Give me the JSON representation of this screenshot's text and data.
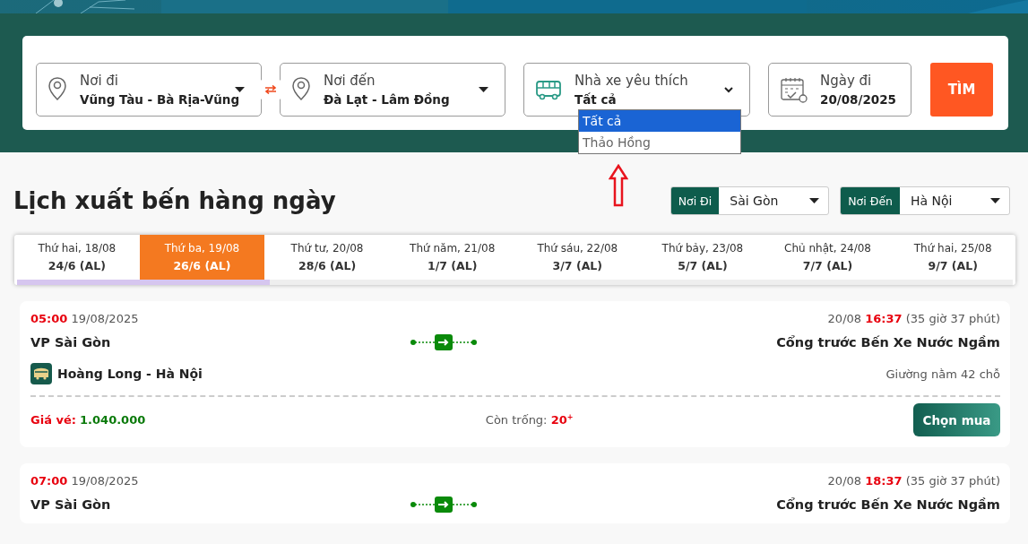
{
  "search": {
    "fields": [
      {
        "kind": "place",
        "label": "Nơi đi",
        "value": "Vũng Tàu - Bà Rịa-Vũng",
        "caret": true
      },
      {
        "kind": "place",
        "label": "Nơi đến",
        "value": "Đà Lạt - Lâm Đồng",
        "caret": true
      },
      {
        "kind": "operator",
        "label": "Nhà xe yêu thích",
        "value": "Tất cả",
        "expanded": true,
        "options": [
          {
            "label": "Tất cả",
            "selected": true
          },
          {
            "label": "Thảo Hồng",
            "selected": false
          }
        ]
      },
      {
        "kind": "date",
        "label": "Ngày đi",
        "value": "20/08/2025"
      }
    ],
    "button": "TÌM"
  },
  "schedule": {
    "title": "Lịch xuất bến hàng ngày",
    "filters": [
      {
        "label": "Nơi Đi",
        "value": "Sài Gòn"
      },
      {
        "label": "Nơi Đến",
        "value": "Hà Nội"
      }
    ],
    "days": [
      {
        "day": "Thứ hai, 18/08",
        "lunar": "24/6 (AL)",
        "selected": false
      },
      {
        "day": "Thứ ba, 19/08",
        "lunar": "26/6 (AL)",
        "selected": true
      },
      {
        "day": "Thứ tư, 20/08",
        "lunar": "28/6 (AL)",
        "selected": false
      },
      {
        "day": "Thứ năm, 21/08",
        "lunar": "1/7 (AL)",
        "selected": false
      },
      {
        "day": "Thứ sáu, 22/08",
        "lunar": "3/7 (AL)",
        "selected": false
      },
      {
        "day": "Thứ bảy, 23/08",
        "lunar": "5/7 (AL)",
        "selected": false
      },
      {
        "day": "Chủ nhật, 24/08",
        "lunar": "7/7 (AL)",
        "selected": false
      },
      {
        "day": "Thứ hai, 25/08",
        "lunar": "9/7 (AL)",
        "selected": false
      }
    ],
    "trips": [
      {
        "depart_time": "05:00",
        "depart_date": "19/08/2025",
        "arrive_date": "20/08",
        "arrive_time": "16:37",
        "duration": "(35 giờ 37 phút)",
        "from": "VP Sài Gòn",
        "to": "Cổng trước Bến Xe Nước Ngầm",
        "operator": "Hoàng Long - Hà Nội",
        "seat_type": "Giường nằm 42 chỗ",
        "price_label": "Giá vé:",
        "price": "1.040.000",
        "seats_label": "Còn trống:",
        "seats": "20$^{+}$",
        "button": "Chọn mua"
      },
      {
        "depart_time": "07:00",
        "depart_date": "19/08/2025",
        "arrive_date": "20/08",
        "arrive_time": "18:37",
        "duration": "(35 giờ 37 phút)",
        "from": "VP Sài Gòn",
        "to": "Cổng trước Bến Xe Nước Ngầm"
      }
    ]
  }
}
